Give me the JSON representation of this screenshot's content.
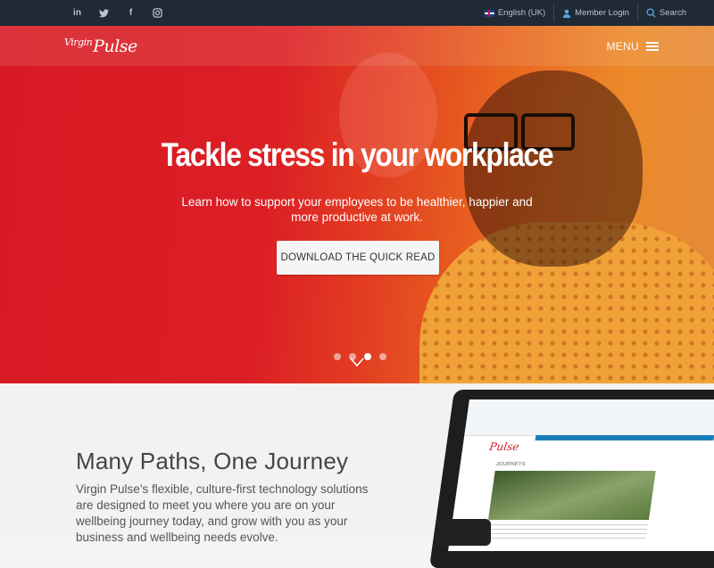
{
  "topbar": {
    "social": [
      {
        "name": "linkedin-icon",
        "glyph": "in"
      },
      {
        "name": "twitter-icon",
        "glyph": "🐦"
      },
      {
        "name": "facebook-icon",
        "glyph": "f"
      },
      {
        "name": "instagram-icon",
        "glyph": "◎"
      }
    ],
    "language_label": "English (UK)",
    "member_login_label": "Member Login",
    "search_label": "Search"
  },
  "nav": {
    "logo_text": "Pulse",
    "logo_prefix": "Virgin",
    "menu_label": "MENU"
  },
  "hero": {
    "headline": "Tackle stress in your workplace",
    "subtext": "Learn how to support your employees to be healthier, happier and more productive at work.",
    "cta_label": "DOWNLOAD THE QUICK READ",
    "slides": 4,
    "active_slide": 3
  },
  "section": {
    "heading": "Many Paths, One Journey",
    "paragraph": "Virgin Pulse’s flexible, culture-first technology solutions are designed to meet you where you are on your wellbeing journey today, and grow with you as your business and wellbeing needs evolve."
  },
  "colors": {
    "topbar_bg": "#1f2a35",
    "brand_red": "#d71a24",
    "accent_orange": "#ec8a2a"
  }
}
